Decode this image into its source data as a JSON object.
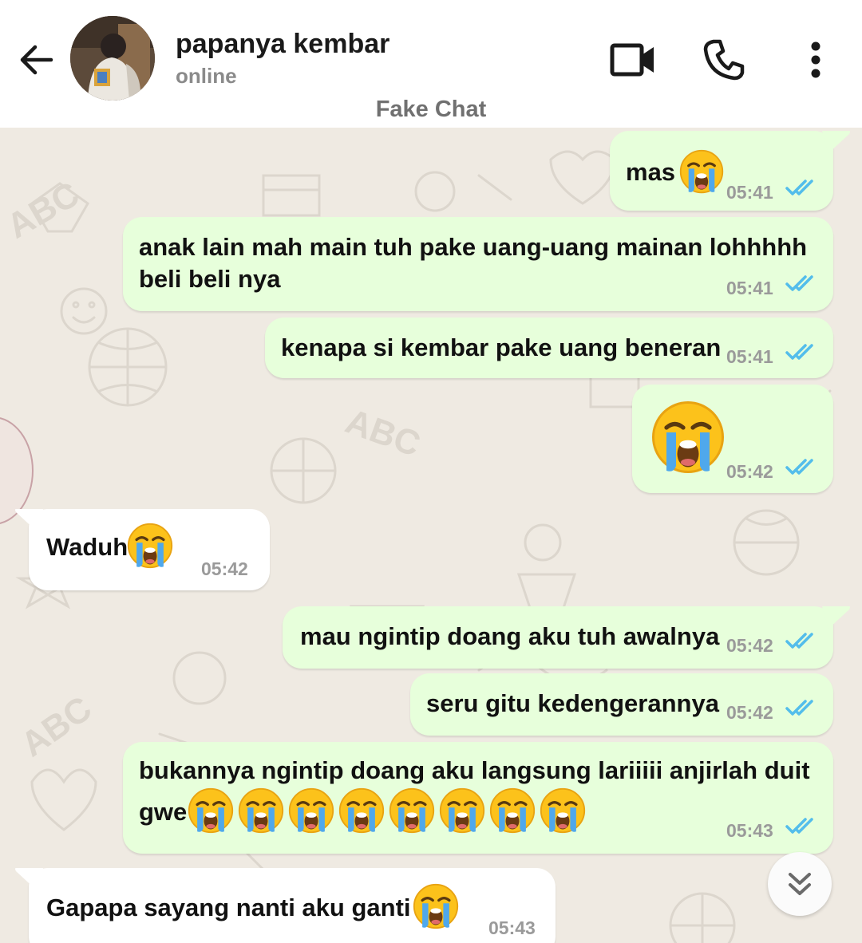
{
  "header": {
    "contact_name": "papanya kembar",
    "contact_status": "online",
    "watermark": "Fake Chat",
    "icons": [
      "back-arrow-icon",
      "video-call-icon",
      "voice-call-icon",
      "more-options-icon"
    ]
  },
  "messages": [
    {
      "dir": "out",
      "text": "mas",
      "emoji_count": 1,
      "time": "05:41",
      "status": "read"
    },
    {
      "dir": "out",
      "text": "anak lain mah main tuh pake uang-uang mainan lohhhhh",
      "text2": "beli beli nya",
      "time": "05:41",
      "status": "read"
    },
    {
      "dir": "out",
      "text": "kenapa si kembar pake uang beneran",
      "time": "05:41",
      "status": "read"
    },
    {
      "dir": "out",
      "text": "",
      "emoji_count": 1,
      "time": "05:42",
      "status": "read"
    },
    {
      "dir": "in",
      "text": "Waduh",
      "emoji_count": 1,
      "time": "05:42"
    },
    {
      "dir": "out",
      "text": "mau ngintip doang aku tuh awalnya",
      "time": "05:42",
      "status": "read"
    },
    {
      "dir": "out",
      "text": "seru gitu kedengerannya",
      "time": "05:42",
      "status": "read"
    },
    {
      "dir": "out",
      "text": "bukannya ngintip doang aku langsung lariiiii anjirlah duit",
      "text2": "gwe",
      "emoji_count": 8,
      "time": "05:43",
      "status": "read"
    },
    {
      "dir": "in",
      "text": "Gapapa sayang nanti aku ganti",
      "emoji_count": 1,
      "time": "05:43"
    }
  ],
  "colors": {
    "outgoing_bubble": "#e7ffdb",
    "incoming_bubble": "#ffffff",
    "chat_background": "#efeae2",
    "read_ticks": "#53bdeb"
  },
  "emoji_name": "loudly-crying-face-icon",
  "scroll_button_icon": "double-chevron-down-icon"
}
